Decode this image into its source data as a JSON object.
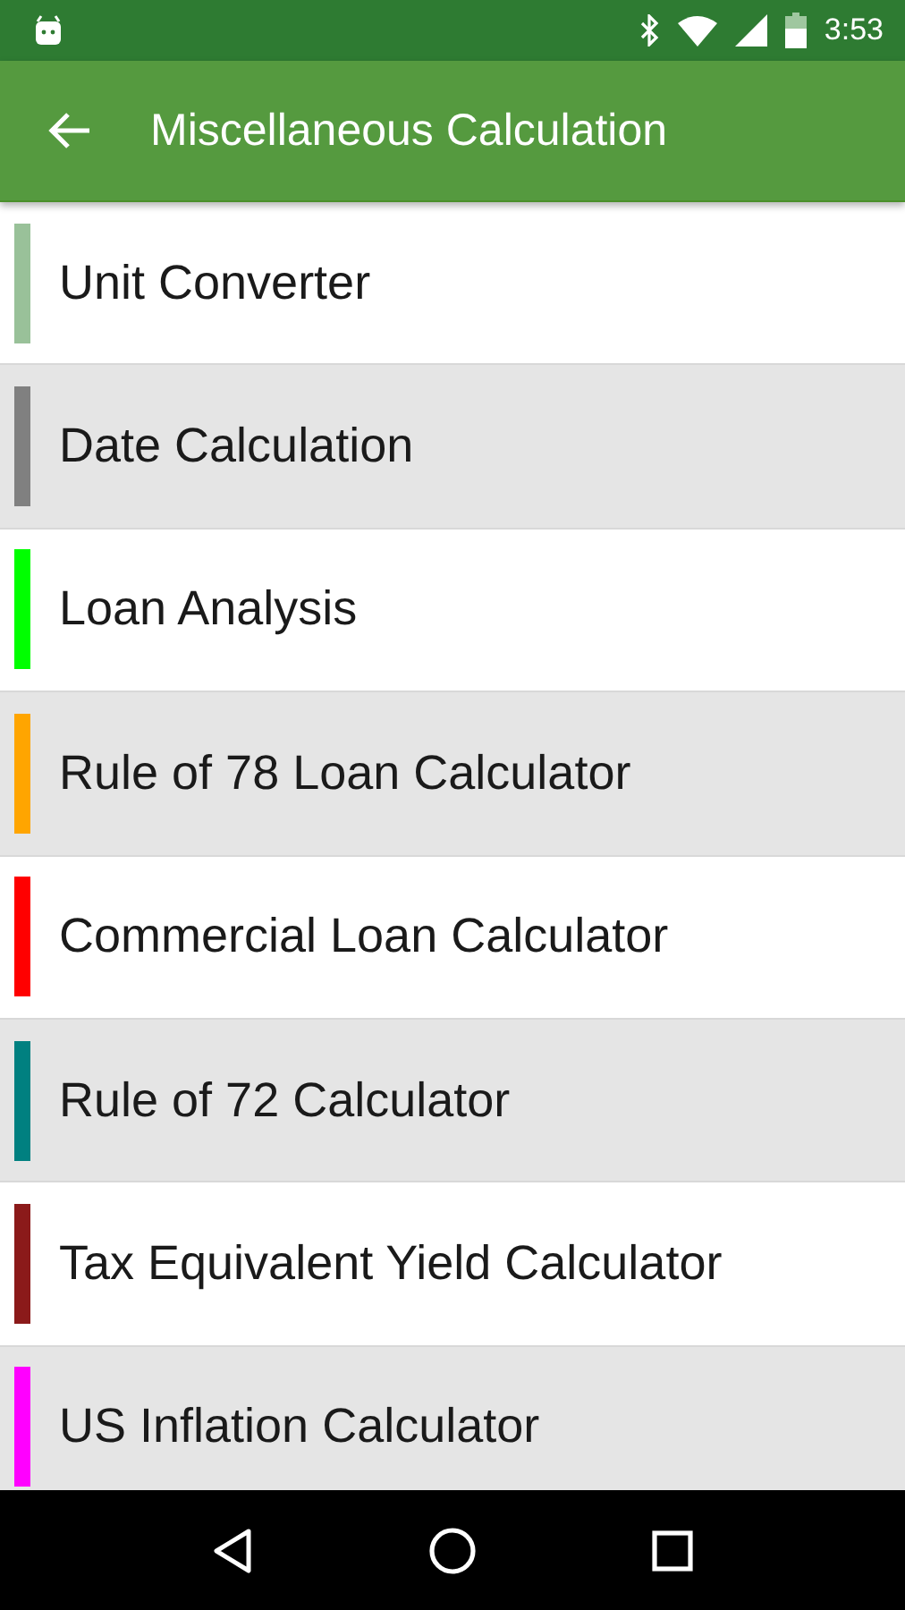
{
  "status_bar": {
    "time": "3:53"
  },
  "toolbar": {
    "title": "Miscellaneous Calculation"
  },
  "items": [
    {
      "label": "Unit Converter",
      "color": "#99c199"
    },
    {
      "label": "Date Calculation",
      "color": "#808080"
    },
    {
      "label": "Loan Analysis",
      "color": "#00ff00"
    },
    {
      "label": "Rule of 78 Loan Calculator",
      "color": "#ffa500"
    },
    {
      "label": "Commercial Loan Calculator",
      "color": "#ff0000"
    },
    {
      "label": "Rule of 72 Calculator",
      "color": "#008080"
    },
    {
      "label": "Tax Equivalent Yield Calculator",
      "color": "#8b1a1a"
    },
    {
      "label": "US Inflation Calculator",
      "color": "#ff00ff"
    }
  ]
}
